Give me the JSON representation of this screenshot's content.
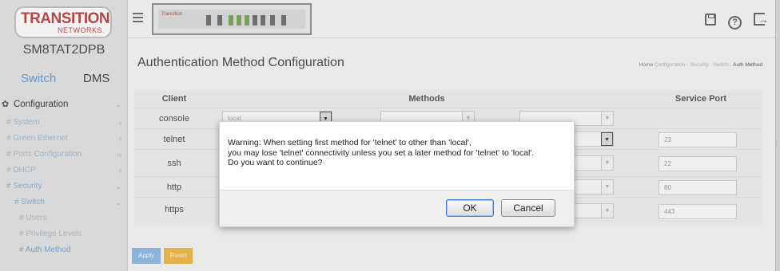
{
  "sidebar": {
    "logo_main": "TRANSITION",
    "logo_sub": "NETWORKS.",
    "device_name": "SM8TAT2DPB",
    "mode_switch": "Switch",
    "mode_dms": "DMS",
    "configuration": "Configuration",
    "items": [
      {
        "label": "# System"
      },
      {
        "label": "# Green Ethernet"
      },
      {
        "label": "# Ports Configuration"
      },
      {
        "label": "# DHCP"
      },
      {
        "label": "# Security"
      },
      {
        "label": "# Switch"
      },
      {
        "label": "# Users"
      },
      {
        "label": "# Privilege Levels"
      },
      {
        "label": "# Auth Method"
      }
    ]
  },
  "topbar": {
    "device_brand": "Transition",
    "icons": [
      "save-icon",
      "help-icon",
      "logout-icon"
    ]
  },
  "page": {
    "title": "Authentication Method Configuration",
    "breadcrumb": {
      "home": "Home",
      "path": "Configuration · Security · Switch ·",
      "current": "Auth Method"
    }
  },
  "table": {
    "headers": {
      "client": "Client",
      "methods": "Methods",
      "service_port": "Service Port"
    },
    "rows": [
      {
        "client": "console",
        "method1": "local",
        "port": ""
      },
      {
        "client": "telnet",
        "method1": "",
        "port": "23"
      },
      {
        "client": "ssh",
        "method1": "",
        "port": "22"
      },
      {
        "client": "http",
        "method1": "",
        "port": "80"
      },
      {
        "client": "https",
        "method1": "",
        "port": "443"
      }
    ]
  },
  "buttons": {
    "apply": "Apply",
    "reset": "Reset"
  },
  "dialog": {
    "line1": "Warning: When setting first method for 'telnet' to other than 'local',",
    "line2": "you may lose 'telnet' connectivity unless you set a later method for 'telnet' to 'local'.",
    "line3": "Do you want to continue?",
    "ok": "OK",
    "cancel": "Cancel"
  }
}
